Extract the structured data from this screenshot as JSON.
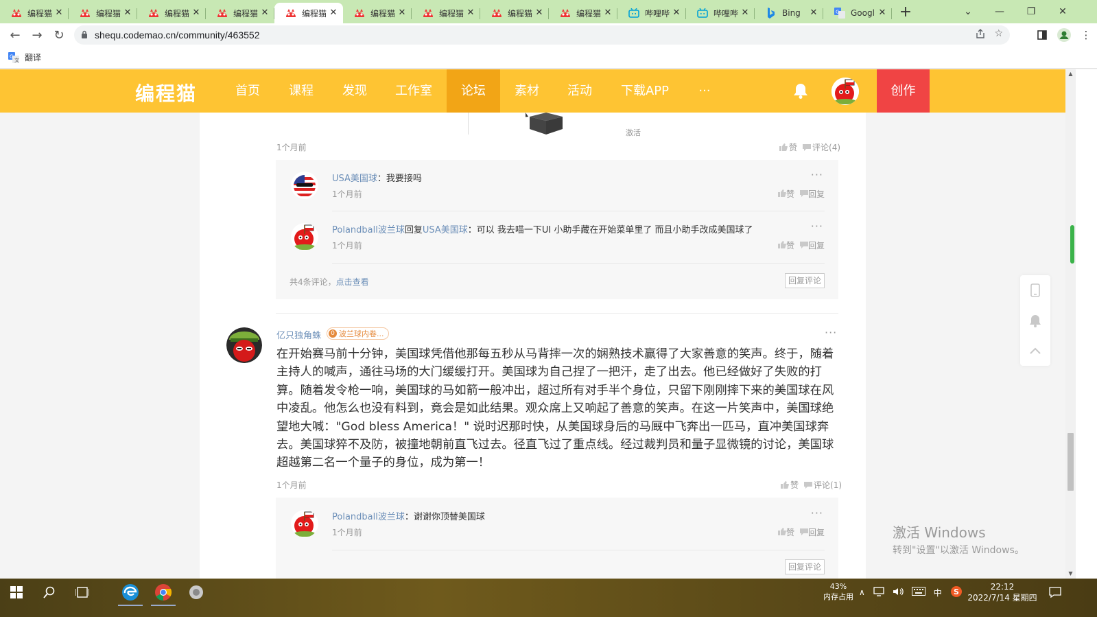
{
  "browser": {
    "tabs": [
      {
        "title": "编程猫",
        "icon": "codemao-icon",
        "active": false
      },
      {
        "title": "编程猫",
        "icon": "codemao-icon",
        "active": false
      },
      {
        "title": "编程猫",
        "icon": "codemao-icon",
        "active": false
      },
      {
        "title": "编程猫",
        "icon": "codemao-icon",
        "active": false
      },
      {
        "title": "编程猫",
        "icon": "codemao-icon",
        "active": true
      },
      {
        "title": "编程猫",
        "icon": "codemao-icon",
        "active": false
      },
      {
        "title": "编程猫",
        "icon": "codemao-icon",
        "active": false
      },
      {
        "title": "编程猫",
        "icon": "codemao-icon",
        "active": false
      },
      {
        "title": "编程猫",
        "icon": "codemao-icon",
        "active": false
      },
      {
        "title": "哔哩哔",
        "icon": "bilibili-icon",
        "active": false
      },
      {
        "title": "哔哩哔",
        "icon": "bilibili-icon",
        "active": false
      },
      {
        "title": "Bing",
        "icon": "bing-icon",
        "active": false
      },
      {
        "title": "Googl",
        "icon": "google-translate-icon",
        "active": false
      }
    ],
    "new_tab": "+",
    "url": "shequ.codemao.cn/community/463552",
    "bookmark_label": "翻译"
  },
  "site": {
    "logo": "编程猫",
    "nav": [
      {
        "label": "首页",
        "active": false
      },
      {
        "label": "课程",
        "active": false
      },
      {
        "label": "发现",
        "active": false
      },
      {
        "label": "工作室",
        "active": false
      },
      {
        "label": "论坛",
        "active": true
      },
      {
        "label": "素材",
        "active": false
      },
      {
        "label": "活动",
        "active": false
      },
      {
        "label": "下载APP",
        "active": false
      },
      {
        "label": "···",
        "active": false
      }
    ],
    "create_label": "创作"
  },
  "post_prev": {
    "stone_caption": "激活",
    "time": "1个月前",
    "like": "赞",
    "comment": "评论(4)",
    "replies": [
      {
        "name": "USA美国球",
        "sep": "：",
        "text": "我要接吗",
        "time": "1个月前",
        "like": "赞",
        "reply": "回复",
        "more": "···"
      },
      {
        "name": "Polandball波兰球",
        "mid": "回复",
        "target": "USA美国球",
        "sep": "：",
        "text": "可以 我去喵一下UI 小助手藏在开始菜单里了 而且小助手改成美国球了",
        "time": "1个月前",
        "like": "赞",
        "reply": "回复",
        "more": "···"
      }
    ],
    "footer_prefix": "共4条评论，",
    "footer_link": "点击查看",
    "reply_btn": "回复评论"
  },
  "comment": {
    "author": "亿只独角蛛",
    "badge_dot": "0",
    "badge": "波兰球内卷...",
    "more": "···",
    "body": "在开始赛马前十分钟，美国球凭借他那每五秒从马背摔一次的娴熟技术赢得了大家善意的笑声。终于，随着主持人的喊声，通往马场的大门缓缓打开。美国球为自己捏了一把汗，走了出去。他已经做好了失败的打算。随着发令枪一响，美国球的马如箭一般冲出，超过所有对手半个身位，只留下刚刚摔下来的美国球在风中凌乱。他怎么也没有料到，竟会是如此结果。观众席上又响起了善意的笑声。在这一片笑声中，美国球绝望地大喊：\"God bless America！\" 说时迟那时快，从美国球身后的马厩中飞奔出一匹马，直冲美国球奔去。美国球猝不及防，被撞地朝前直飞过去。径直飞过了重点线。经过裁判员和量子显微镜的讨论，美国球超越第二名一个量子的身位，成为第一！",
    "time": "1个月前",
    "like": "赞",
    "comment_count": "评论(1)",
    "replies": [
      {
        "name": "Polandball波兰球",
        "sep": "：",
        "text": "谢谢你顶替美国球",
        "time": "1个月前",
        "like": "赞",
        "reply": "回复",
        "more": "···"
      }
    ],
    "reply_btn": "回复评论"
  },
  "watermark": {
    "line1": "激活 Windows",
    "line2": "转到\"设置\"以激活 Windows。"
  },
  "taskbar": {
    "mem_percent": "43%",
    "mem_label": "内存占用",
    "ime": "中",
    "time": "22:12",
    "date": "2022/7/14 星期四"
  },
  "colors": {
    "site_yellow": "#fec433",
    "nav_active": "#f2a516",
    "create_red": "#f04444",
    "link_blue": "#6c8fb8"
  }
}
